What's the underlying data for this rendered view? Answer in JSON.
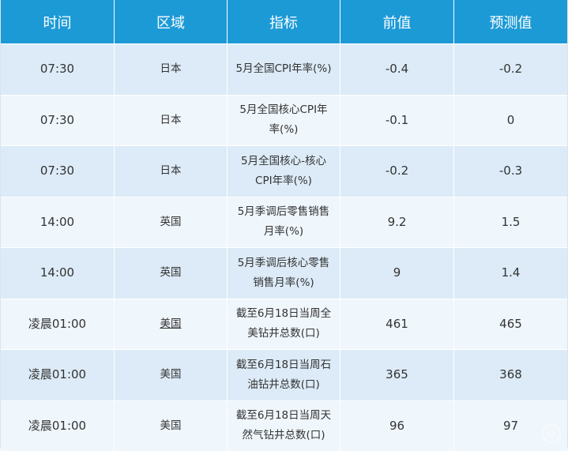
{
  "table": {
    "headers": [
      "时间",
      "区域",
      "指标",
      "前值",
      "预测值"
    ],
    "rows": [
      {
        "time": "07:30",
        "region": "日本",
        "indicator": "5月全国CPI年率(%)",
        "previous": "-0.4",
        "forecast": "-0.2"
      },
      {
        "time": "07:30",
        "region": "日本",
        "indicator": "5月全国核心CPI年率(%)",
        "previous": "-0.1",
        "forecast": "0"
      },
      {
        "time": "07:30",
        "region": "日本",
        "indicator": "5月全国核心-核心CPI年率(%)",
        "previous": "-0.2",
        "forecast": "-0.3"
      },
      {
        "time": "14:00",
        "region": "英国",
        "indicator": "5月季调后零售销售月率(%)",
        "previous": "9.2",
        "forecast": "1.5"
      },
      {
        "time": "14:00",
        "region": "英国",
        "indicator": "5月季调后核心零售销售月率(%)",
        "previous": "9",
        "forecast": "1.4"
      },
      {
        "time": "凌晨01:00",
        "region": "美国",
        "indicator": "截至6月18日当周全美钻井总数(口)",
        "previous": "461",
        "forecast": "465"
      },
      {
        "time": "凌晨01:00",
        "region": "美国",
        "indicator": "截至6月18日当周石油钻井总数(口)",
        "previous": "365",
        "forecast": "368"
      },
      {
        "time": "凌晨01:00",
        "region": "美国",
        "indicator": "截至6月18日当周天然气钻井总数(口)",
        "previous": "96",
        "forecast": "97"
      }
    ]
  },
  "colors": {
    "header_bg": "#1c9ad6",
    "row_odd_bg": "#dcebf7",
    "row_even_bg": "#eff6fc",
    "text": "#333333"
  },
  "watermark": {
    "icon": "watermark-logo-icon"
  }
}
